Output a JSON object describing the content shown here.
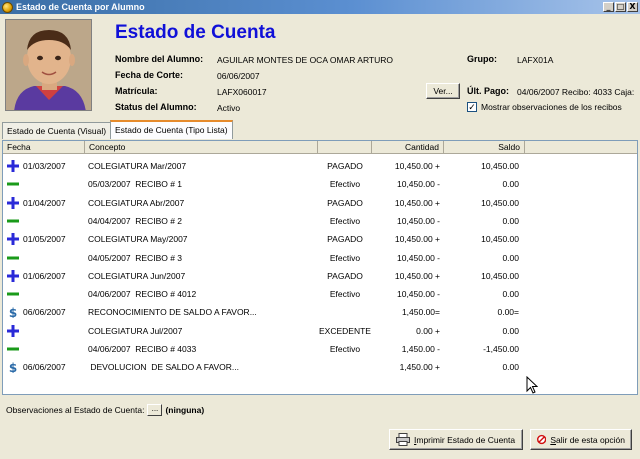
{
  "window": {
    "title": "Estado de Cuenta por Alumno",
    "buttons": [
      "_",
      "□",
      "X"
    ]
  },
  "header": {
    "title": "Estado de Cuenta",
    "fields": [
      {
        "label": "Nombre del Alumno:",
        "value": "AGUILAR MONTES DE OCA OMAR ARTURO"
      },
      {
        "label": "Fecha de Corte:",
        "value": "06/06/2007"
      },
      {
        "label": "Matrícula:",
        "value": "LAFX060017"
      },
      {
        "label": "Status del Alumno:",
        "value": "Activo"
      }
    ],
    "grupo": {
      "label": "Grupo:",
      "value": "LAFX01A"
    },
    "ver_button": "Ver...",
    "ult_pago": {
      "label": "Últ. Pago:",
      "value": "04/06/2007 Recibo: 4033 Caja:"
    },
    "show_obs": {
      "label": "Mostrar observaciones de los recibos",
      "checked": true
    }
  },
  "tabs": [
    {
      "label": "Estado de Cuenta (Visual)",
      "active": false
    },
    {
      "label": "Estado de Cuenta (Tipo Lista)",
      "active": true
    }
  ],
  "table": {
    "columns": [
      "Fecha",
      "Concepto",
      "",
      "Cantidad",
      "Saldo"
    ],
    "rows": [
      {
        "icon": "plus",
        "fecha": "01/03/2007",
        "concepto": "COLEGIATURA Mar/2007",
        "tipo": "PAGADO",
        "cantidad": "10,450.00 +",
        "saldo": "10,450.00"
      },
      {
        "icon": "minus",
        "fecha": "",
        "concepto": "05/03/2007  RECIBO # 1",
        "tipo": "Efectivo",
        "cantidad": "10,450.00 -",
        "saldo": "0.00"
      },
      {
        "icon": "plus",
        "fecha": "01/04/2007",
        "concepto": "COLEGIATURA Abr/2007",
        "tipo": "PAGADO",
        "cantidad": "10,450.00 +",
        "saldo": "10,450.00"
      },
      {
        "icon": "minus",
        "fecha": "",
        "concepto": "04/04/2007  RECIBO # 2",
        "tipo": "Efectivo",
        "cantidad": "10,450.00 -",
        "saldo": "0.00"
      },
      {
        "icon": "plus",
        "fecha": "01/05/2007",
        "concepto": "COLEGIATURA May/2007",
        "tipo": "PAGADO",
        "cantidad": "10,450.00 +",
        "saldo": "10,450.00"
      },
      {
        "icon": "minus",
        "fecha": "",
        "concepto": "04/05/2007  RECIBO # 3",
        "tipo": "Efectivo",
        "cantidad": "10,450.00 -",
        "saldo": "0.00"
      },
      {
        "icon": "plus",
        "fecha": "01/06/2007",
        "concepto": "COLEGIATURA Jun/2007",
        "tipo": "PAGADO",
        "cantidad": "10,450.00 +",
        "saldo": "10,450.00"
      },
      {
        "icon": "minus",
        "fecha": "",
        "concepto": "04/06/2007  RECIBO # 4012",
        "tipo": "Efectivo",
        "cantidad": "10,450.00 -",
        "saldo": "0.00"
      },
      {
        "icon": "dollar",
        "fecha": "06/06/2007",
        "concepto": "RECONOCIMIENTO DE SALDO A FAVOR...",
        "tipo": "",
        "cantidad": "1,450.00=",
        "saldo": "0.00="
      },
      {
        "icon": "plus",
        "fecha": "",
        "concepto": "COLEGIATURA Jul/2007",
        "tipo": "EXCEDENTE",
        "cantidad": "0.00 +",
        "saldo": "0.00"
      },
      {
        "icon": "minus",
        "fecha": "",
        "concepto": "04/06/2007  RECIBO # 4033",
        "tipo": "Efectivo",
        "cantidad": "1,450.00 -",
        "saldo": "-1,450.00"
      },
      {
        "icon": "dollar",
        "fecha": "06/06/2007",
        "concepto": " DEVOLUCION  DE SALDO A FAVOR...",
        "tipo": "",
        "cantidad": "1,450.00 +",
        "saldo": "0.00"
      }
    ]
  },
  "footer": {
    "obs_label": "Observaciones al Estado de Cuenta:",
    "obs_button": "...",
    "obs_value": "(ninguna)",
    "print_button": {
      "mnemonic": "I",
      "rest": "mprimir Estado de Cuenta"
    },
    "exit_button": {
      "mnemonic": "S",
      "rest": "alir de esta opción"
    }
  },
  "colors": {
    "title": "#1010d8",
    "plus": "#2a2ad8",
    "minus": "#1a9a1a",
    "dollar": "#2a6aa8"
  }
}
